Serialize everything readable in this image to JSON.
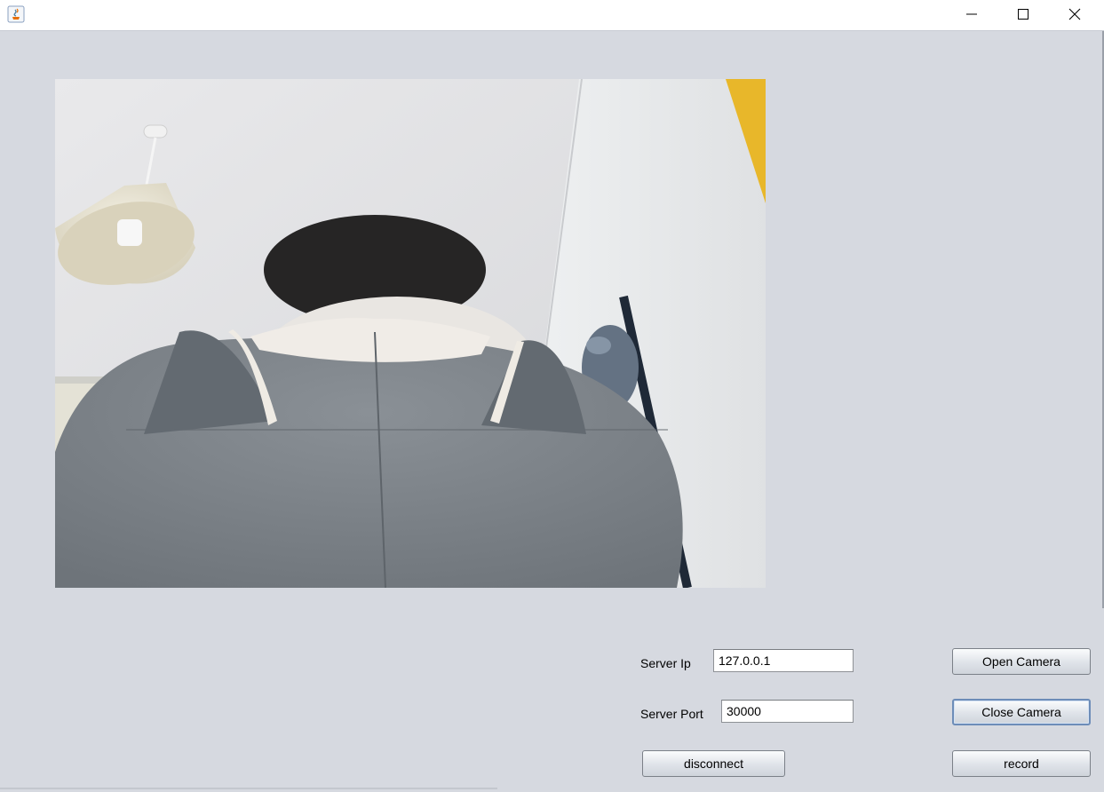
{
  "window": {
    "title": "",
    "controls": {
      "minimize": "minimize-icon",
      "maximize": "maximize-icon",
      "close": "close-icon"
    }
  },
  "video": {
    "description_icon": "camera-feed"
  },
  "form": {
    "server_ip_label": "Server Ip",
    "server_ip_value": "127.0.0.1",
    "server_port_label": "Server Port",
    "server_port_value": "30000"
  },
  "buttons": {
    "open_camera": "Open Camera",
    "close_camera": "Close Camera",
    "disconnect": "disconnect",
    "record": "record"
  },
  "colors": {
    "background": "#d6d9e0",
    "titlebar": "#ffffff",
    "focus_border": "#6d8db8"
  }
}
